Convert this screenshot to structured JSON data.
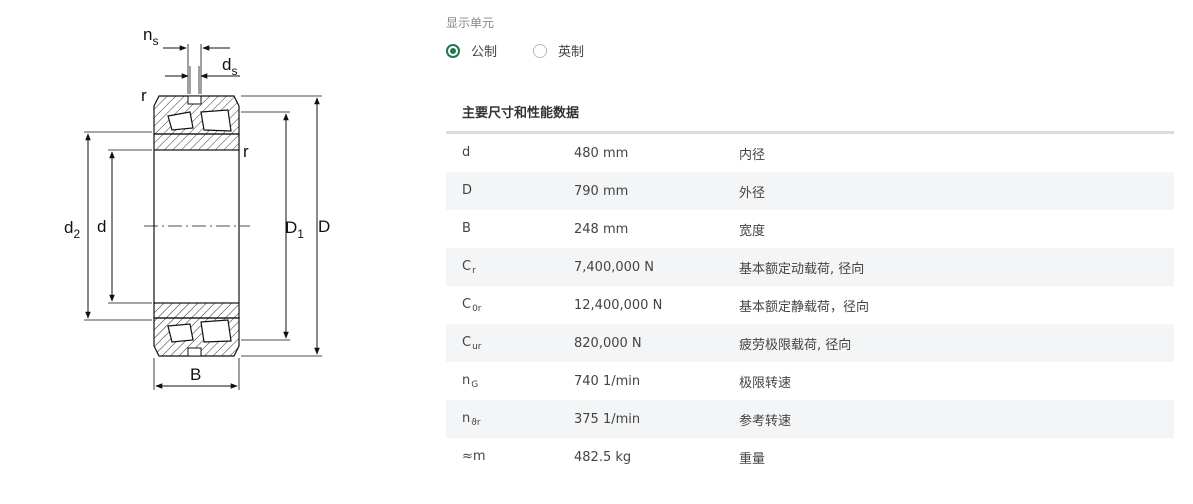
{
  "drawing": {
    "labels": {
      "ns": "n",
      "ns_sub": "s",
      "ds": "d",
      "ds_sub": "s",
      "r_top": "r",
      "r_right": "r",
      "d2": "d",
      "d2_sub": "2",
      "d": "d",
      "D1": "D",
      "D1_sub": "1",
      "D": "D",
      "B": "B"
    }
  },
  "units": {
    "label": "显示单元",
    "options": [
      {
        "label": "公制",
        "selected": true
      },
      {
        "label": "英制",
        "selected": false
      }
    ]
  },
  "specs": {
    "title": "主要尺寸和性能数据",
    "rows": [
      {
        "sym": "d",
        "sub": "",
        "value": "480 mm",
        "desc": "内径"
      },
      {
        "sym": "D",
        "sub": "",
        "value": "790 mm",
        "desc": "外径"
      },
      {
        "sym": "B",
        "sub": "",
        "value": "248 mm",
        "desc": "宽度"
      },
      {
        "sym": "C",
        "sub": "r",
        "value": "7,400,000 N",
        "desc": "基本额定动载荷, 径向"
      },
      {
        "sym": "C",
        "sub": "0r",
        "value": "12,400,000 N",
        "desc": "基本额定静载荷，径向"
      },
      {
        "sym": "C",
        "sub": "ur",
        "value": "820,000 N",
        "desc": "疲劳极限载荷, 径向"
      },
      {
        "sym": "n",
        "sub": "G",
        "value": "740 1/min",
        "desc": "极限转速"
      },
      {
        "sym": "n",
        "sub": "ϑr",
        "value": "375 1/min",
        "desc": "参考转速"
      },
      {
        "sym": "≈m",
        "sub": "",
        "value": "482.5 kg",
        "desc": "重量"
      }
    ]
  }
}
